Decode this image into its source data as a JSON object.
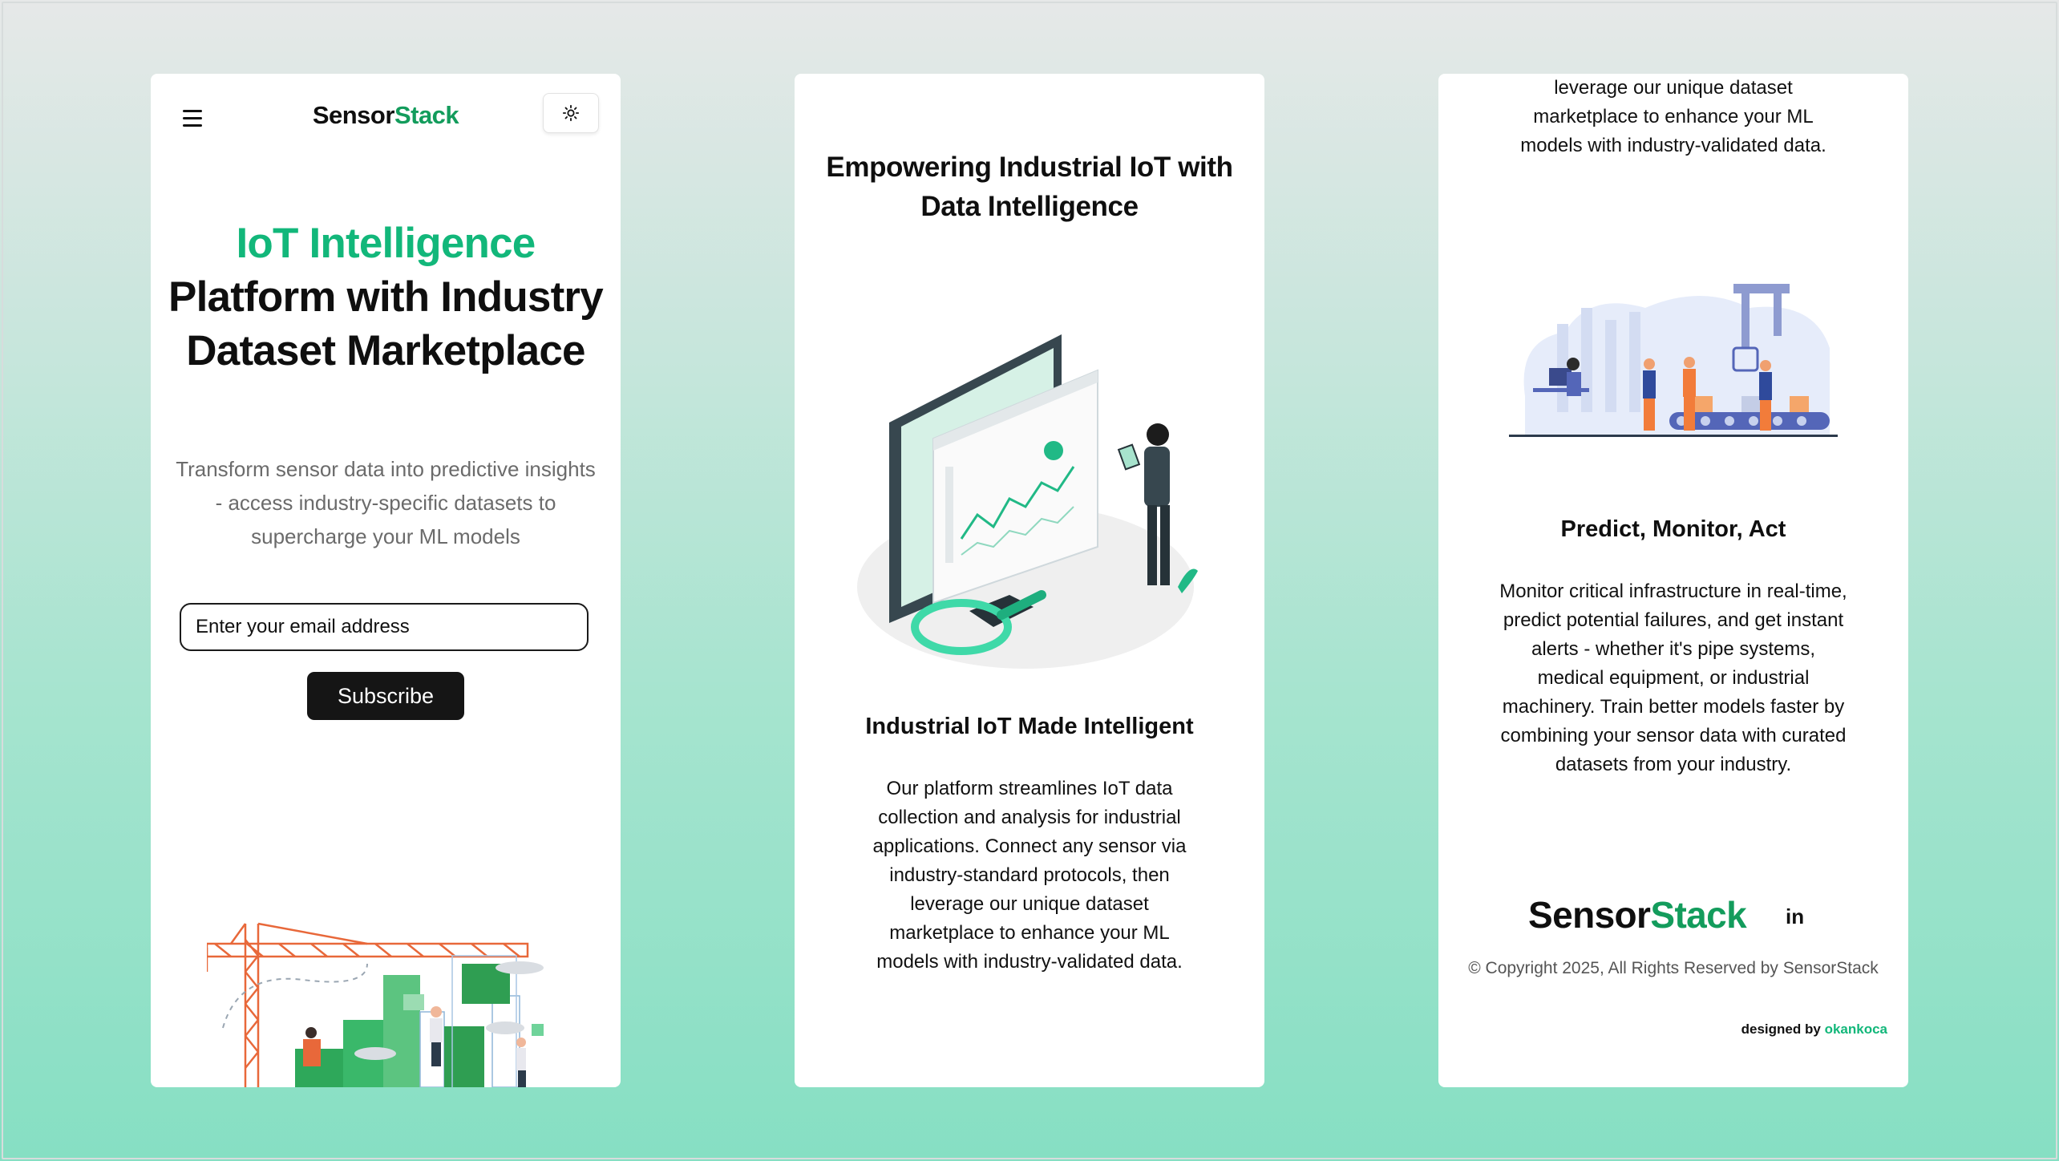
{
  "brand": {
    "part1": "Sensor",
    "part2": "Stack",
    "accent_color": "#139c5c",
    "highlight_color": "#12b77a"
  },
  "panel1": {
    "menu_icon": "hamburger-menu-icon",
    "theme_icon": "sun-icon",
    "hero_highlight": "IoT Intelligence",
    "hero_rest": "Platform with Industry Dataset Marketplace",
    "hero_sub": "Transform sensor data into predictive insights - access industry-specific datasets to supercharge your ML models",
    "email_placeholder": "Enter your email address",
    "subscribe_label": "Subscribe"
  },
  "panel2": {
    "title": "Empowering Industrial IoT with Data Intelligence",
    "section_title": "Industrial IoT Made Intelligent",
    "section_body": "Our platform streamlines IoT data collection and analysis for industrial applications. Connect any sensor via industry-standard protocols, then leverage our unique dataset marketplace to enhance your ML models with industry-validated data."
  },
  "panel3": {
    "top_text": "leverage our unique dataset marketplace to enhance your ML models with industry-validated data.",
    "section_title": "Predict, Monitor, Act",
    "section_body": "Monitor critical infrastructure in real-time, predict potential failures, and get instant alerts - whether it's pipe systems, medical equipment, or industrial machinery. Train better models faster by combining your sensor data with curated datasets from your industry.",
    "linkedin_label": "in",
    "copyright": "© Copyright 2025, All Rights Reserved by SensorStack",
    "designed_by": "designed by ",
    "designer": "okankoca"
  }
}
